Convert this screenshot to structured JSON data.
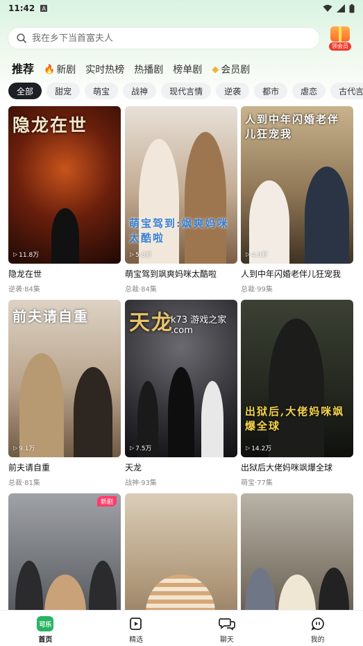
{
  "status_bar": {
    "time": "11:42",
    "notif_letter": "A"
  },
  "search": {
    "placeholder": "我在乡下当首富夫人"
  },
  "member_badge": {
    "label": "领会员"
  },
  "main_tabs": [
    {
      "label": "推荐",
      "active": true
    },
    {
      "label": "新剧",
      "icon": "fire-icon"
    },
    {
      "label": "实时热榜"
    },
    {
      "label": "热播剧"
    },
    {
      "label": "榜单剧"
    },
    {
      "label": "会员剧",
      "icon": "diamond-icon"
    }
  ],
  "categories": [
    "全部",
    "甜宠",
    "萌宝",
    "战神",
    "现代言情",
    "逆袭",
    "都市",
    "虐恋",
    "古代言"
  ],
  "dramas": [
    {
      "title": "隐龙在世",
      "meta": "逆袭·84集",
      "views": "11.8万",
      "poster_text": "隐龙在世",
      "palette": [
        "#3a1208",
        "#a33a12"
      ]
    },
    {
      "title": "萌宝驾到飒爽妈咪太酷啦",
      "meta": "总裁·84集",
      "views": "5.8万",
      "poster_text": "萌宝驾到:飒爽妈咪太酷啦",
      "palette": [
        "#d9cfc3",
        "#8a6d54"
      ]
    },
    {
      "title": "人到中年闪婚老伴儿狂宠我",
      "meta": "总裁·99集",
      "views": "4.0万",
      "poster_text": "人到中年闪婚老伴儿狂宠我",
      "palette": [
        "#b8a27f",
        "#5e4a32"
      ]
    },
    {
      "title": "前夫请自重",
      "meta": "总裁·81集",
      "views": "9.1万",
      "poster_text": "前夫请自重",
      "palette": [
        "#cdbfae",
        "#7f6852"
      ]
    },
    {
      "title": "天龙",
      "meta": "战神·93集",
      "views": "7.5万",
      "poster_text": "天龙",
      "watermark": "k73 游戏之家 .com",
      "palette": [
        "#3c3c40",
        "#1b1b1e"
      ]
    },
    {
      "title": "出狱后大佬妈咪飒爆全球",
      "meta": "萌宝·77集",
      "views": "14.2万",
      "poster_text": "出狱后,大佬妈咪飒爆全球",
      "palette": [
        "#2f3528",
        "#12140f"
      ]
    },
    {
      "title": "",
      "meta": "",
      "views": "",
      "badge": "新剧",
      "palette": [
        "#8c8f93",
        "#4a4d52"
      ]
    },
    {
      "title": "",
      "meta": "",
      "views": "",
      "palette": [
        "#cfc1ab",
        "#8d7b62"
      ]
    },
    {
      "title": "",
      "meta": "",
      "views": "",
      "palette": [
        "#a8a39a",
        "#5b544b"
      ]
    }
  ],
  "bottom_nav": [
    {
      "label": "首页",
      "icon": "home-logo-icon",
      "logo_text": "可乐",
      "active": true
    },
    {
      "label": "精选",
      "icon": "play-square-icon"
    },
    {
      "label": "聊天",
      "icon": "chat-icon"
    },
    {
      "label": "我的",
      "icon": "profile-icon"
    }
  ]
}
